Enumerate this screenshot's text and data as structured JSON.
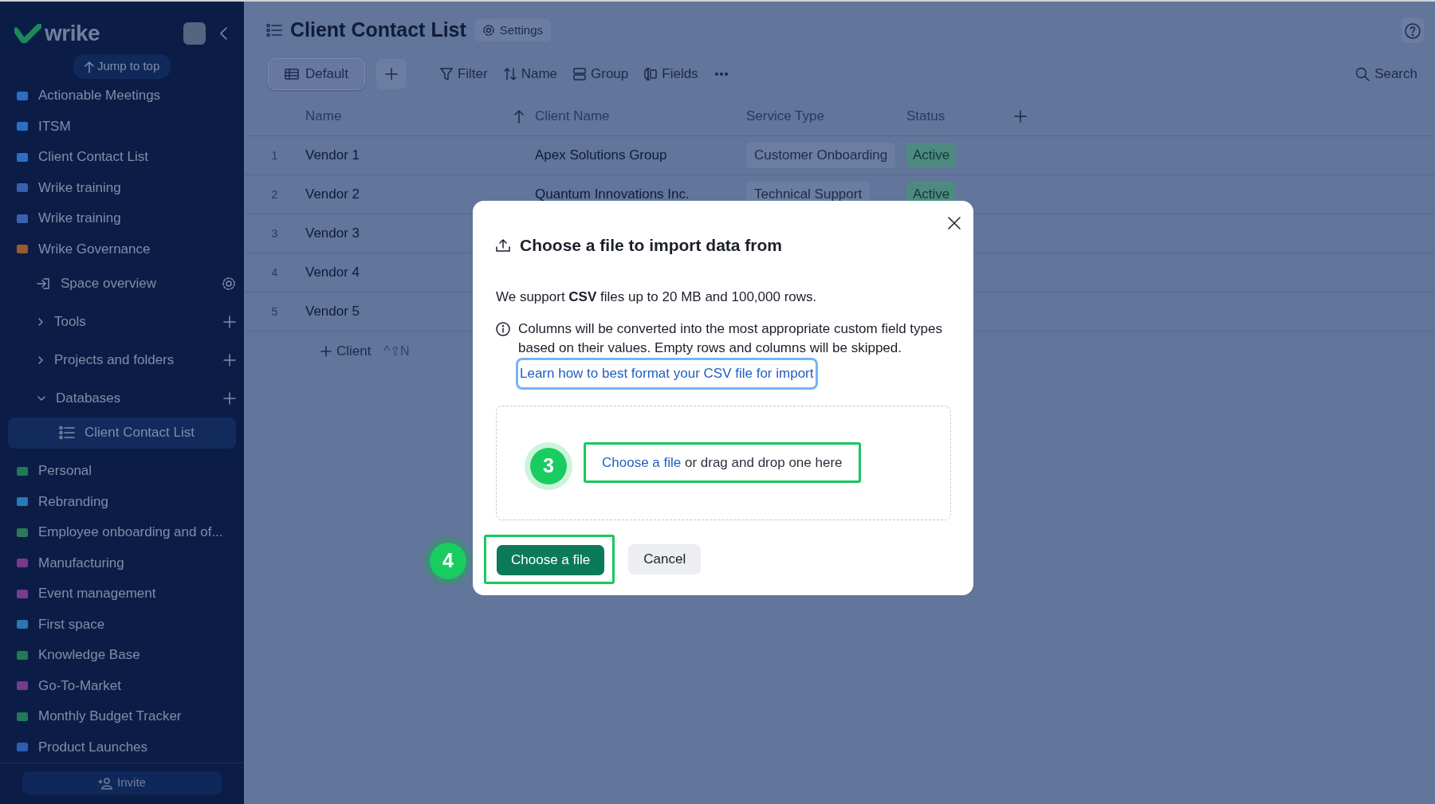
{
  "sidebar": {
    "logo": "wrike",
    "jump_to_top": "Jump to top",
    "items": [
      {
        "kind": "space",
        "label": "Actionable Meetings",
        "color": "#2a6fc4",
        "selected": false
      },
      {
        "kind": "space",
        "label": "ITSM",
        "color": "#2a6fc4",
        "selected": false
      },
      {
        "kind": "space",
        "label": "Client Contact List",
        "color": "#2a6fc4",
        "selected": false
      },
      {
        "kind": "space",
        "label": "Wrike training",
        "color": "#3a5fb0",
        "selected": false
      },
      {
        "kind": "space",
        "label": "Wrike training",
        "color": "#3a5fb0",
        "selected": false
      },
      {
        "kind": "space",
        "label": "Wrike Governance",
        "color": "#9a5a2a",
        "selected": false
      },
      {
        "kind": "overview",
        "label": "Space overview",
        "selected": false
      },
      {
        "kind": "folder",
        "label": "Tools",
        "expanded": false,
        "selected": false
      },
      {
        "kind": "folder",
        "label": "Projects and folders",
        "expanded": false,
        "selected": false
      },
      {
        "kind": "folder",
        "label": "Databases",
        "expanded": true,
        "selected": false
      },
      {
        "kind": "database",
        "label": "Client Contact List",
        "selected": true
      },
      {
        "kind": "space",
        "label": "Personal",
        "color": "#1f7a55",
        "selected": false
      },
      {
        "kind": "space",
        "label": "Rebranding",
        "color": "#2a7ab8",
        "selected": false
      },
      {
        "kind": "space",
        "label": "Employee onboarding and of...",
        "color": "#2a7a55",
        "selected": false
      },
      {
        "kind": "space",
        "label": "Manufacturing",
        "color": "#7a3a8a",
        "selected": false
      },
      {
        "kind": "space",
        "label": "Event management",
        "color": "#7a3a90",
        "selected": false
      },
      {
        "kind": "space",
        "label": "First space",
        "color": "#2a78b0",
        "selected": false
      },
      {
        "kind": "space",
        "label": "Knowledge Base",
        "color": "#1f7a55",
        "selected": false
      },
      {
        "kind": "space",
        "label": "Go-To-Market",
        "color": "#7a3a8a",
        "selected": false
      },
      {
        "kind": "space",
        "label": "Monthly Budget Tracker",
        "color": "#1f7a55",
        "selected": false
      },
      {
        "kind": "space",
        "label": "Product Launches",
        "color": "#2a5fb0",
        "selected": false
      }
    ],
    "invite": "Invite"
  },
  "header": {
    "title": "Client Contact List",
    "settings": "Settings"
  },
  "toolbar": {
    "view": "Default",
    "filter": "Filter",
    "sort": "Name",
    "group": "Group",
    "fields": "Fields",
    "search": "Search"
  },
  "table": {
    "columns": [
      "Name",
      "Client Name",
      "Service Type",
      "Status"
    ],
    "rows": [
      {
        "number": "1",
        "name": "Vendor 1",
        "client": "Apex Solutions Group",
        "service": "Customer Onboarding",
        "status": "Active"
      },
      {
        "number": "2",
        "name": "Vendor 2",
        "client": "Quantum Innovations Inc.",
        "service": "Technical Support",
        "status": "Active"
      },
      {
        "number": "3",
        "name": "Vendor 3"
      },
      {
        "number": "4",
        "name": "Vendor 4"
      },
      {
        "number": "5",
        "name": "Vendor 5"
      }
    ],
    "add_row": "Client",
    "add_shortcut": "^⇧N"
  },
  "dialog": {
    "title": "Choose a file to import data from",
    "intro": "We support **CSV** files up to 20 MB and 100,000 rows.",
    "note": "Columns will be converted into the most appropriate custom field types based on their values. Empty rows and columns will be skipped.",
    "help_link": "Learn how to best format your CSV file for import",
    "drop_link": "Choose a file",
    "drop_text": "or drag and drop one here",
    "primary": "Choose a file",
    "cancel": "Cancel"
  },
  "steps": [
    "3",
    "4"
  ]
}
